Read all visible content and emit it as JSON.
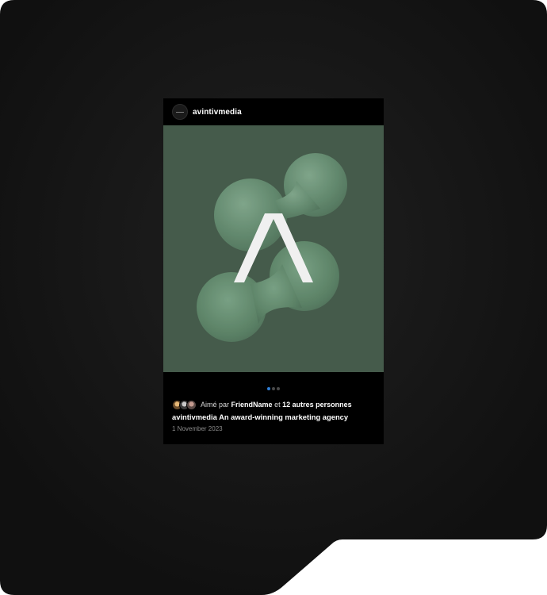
{
  "post": {
    "username": "avintivmedia",
    "avatar_icon": "avintiv-logo-icon",
    "media_logo_icon": "avintiv-a-logo-icon",
    "carousel": {
      "total": 3,
      "active": 1
    },
    "likes": {
      "prefix": "Aimé par",
      "friend": "FriendName",
      "joiner": "et",
      "others": "12 autres personnes"
    },
    "caption": {
      "author": "avintivmedia",
      "text": "An award-winning marketing agency"
    },
    "date": "1 November 2023"
  },
  "colors": {
    "frame": "#121212",
    "media_bg": "#455b4b",
    "blob": "#6e9a7b",
    "active_dot": "#2f7fd8"
  }
}
